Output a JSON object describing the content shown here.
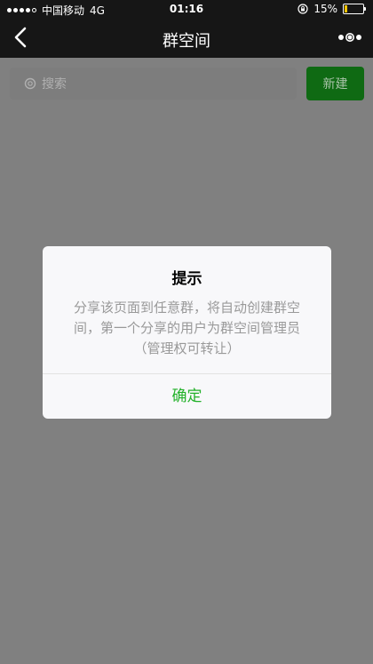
{
  "status_bar": {
    "carrier": "中国移动",
    "network": "4G",
    "time": "01:16",
    "battery": "15%",
    "battery_level": 0.15
  },
  "nav": {
    "title": "群空间"
  },
  "search": {
    "placeholder": "搜索",
    "new_button": "新建"
  },
  "dialog": {
    "title": "提示",
    "body": "分享该页面到任意群，将自动创建群空间，第一个分享的用户为群空间管理员（管理权可转让）",
    "confirm": "确定"
  },
  "colors": {
    "accent_green": "#23b12a",
    "new_button_bg": "#0f6a13",
    "overlay": "#808080"
  }
}
